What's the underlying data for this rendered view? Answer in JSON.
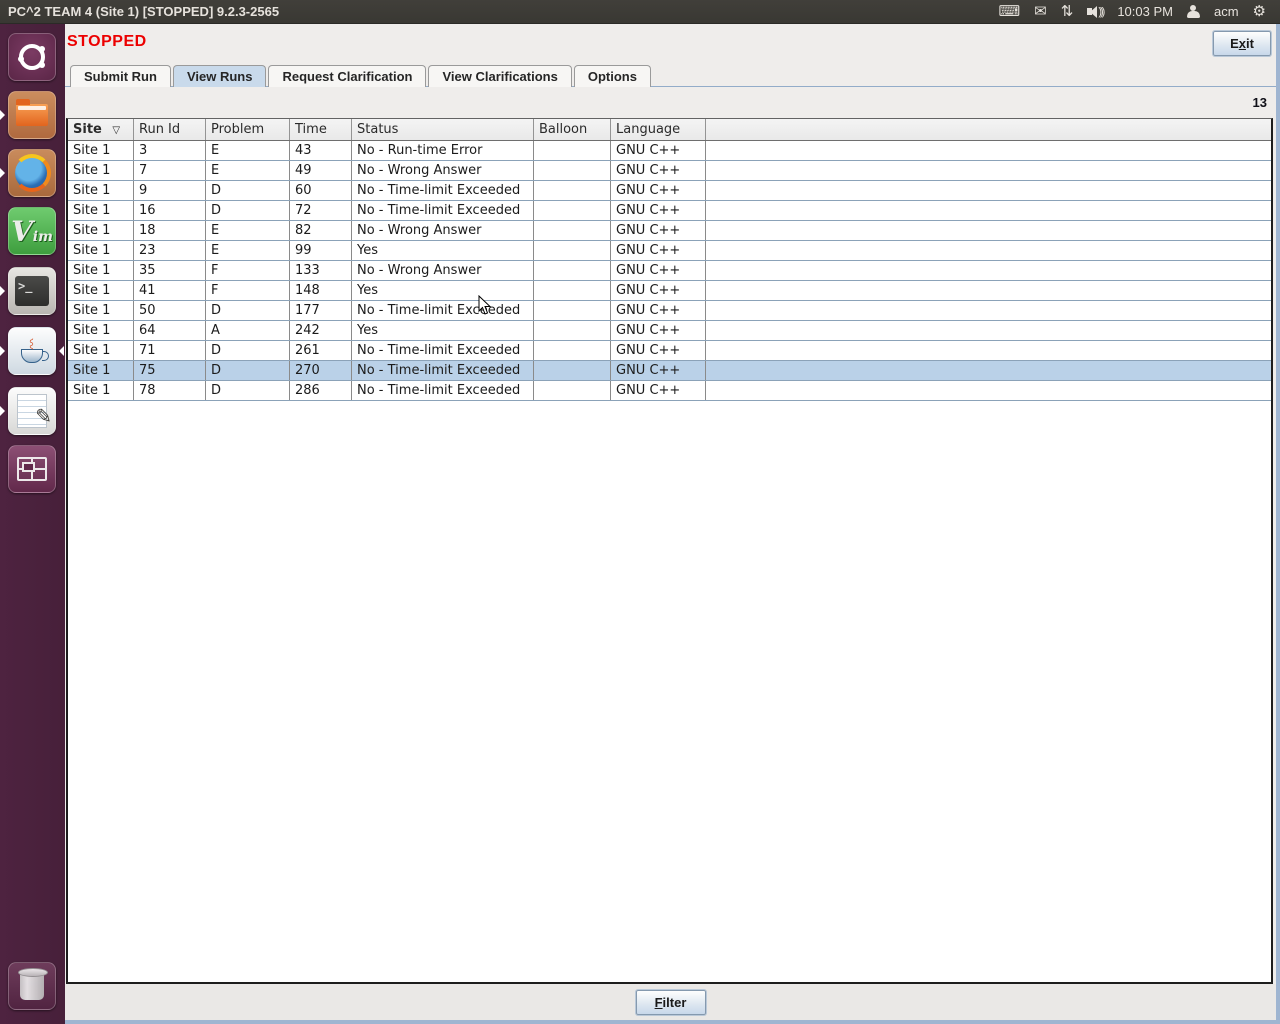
{
  "top_bar": {
    "title": "PC^2 TEAM 4 (Site 1) [STOPPED] 9.2.3-2565",
    "clock": "10:03 PM",
    "username": "acm",
    "keyboard_icon": "⌨",
    "mail_icon": "✉",
    "network_icon": "⇅",
    "speaker_waves": ")))",
    "gear_icon": "⚙"
  },
  "launcher": {
    "items": [
      {
        "name": "dash-home",
        "label": "Dash Home",
        "running": false,
        "focused": false
      },
      {
        "name": "files",
        "label": "Files",
        "running": true,
        "focused": false
      },
      {
        "name": "firefox",
        "label": "Firefox",
        "running": true,
        "focused": false
      },
      {
        "name": "vim",
        "label": "Vim",
        "running": false,
        "focused": false
      },
      {
        "name": "terminal",
        "label": "Terminal",
        "running": true,
        "focused": false
      },
      {
        "name": "java",
        "label": "Java",
        "running": true,
        "focused": true
      },
      {
        "name": "text-editor",
        "label": "Text Editor",
        "running": true,
        "focused": false
      },
      {
        "name": "workspace-switcher",
        "label": "Workspace Switcher",
        "running": false,
        "focused": false
      },
      {
        "name": "trash",
        "label": "Trash",
        "running": false,
        "focused": false
      }
    ]
  },
  "window": {
    "status_label": "STOPPED",
    "exit_button": {
      "pre": "E",
      "key": "x",
      "post": "it"
    },
    "tabs": [
      {
        "label": "Submit Run",
        "selected": false
      },
      {
        "label": "View Runs",
        "selected": true
      },
      {
        "label": "Request Clarification",
        "selected": false
      },
      {
        "label": "View Clarifications",
        "selected": false
      },
      {
        "label": "Options",
        "selected": false
      }
    ],
    "run_count": "13",
    "filter_button": {
      "pre": "",
      "key": "F",
      "post": "ilter"
    }
  },
  "table": {
    "columns": [
      "Site",
      "Run Id",
      "Problem",
      "Time",
      "Status",
      "Balloon",
      "Language"
    ],
    "sort_column": "Site",
    "sort_indicator": "▽",
    "selected_run_id": "75",
    "rows": [
      {
        "site": "Site 1",
        "run_id": "3",
        "problem": "E",
        "time": "43",
        "status": "No - Run-time Error",
        "balloon": "",
        "language": "GNU C++"
      },
      {
        "site": "Site 1",
        "run_id": "7",
        "problem": "E",
        "time": "49",
        "status": "No - Wrong Answer",
        "balloon": "",
        "language": "GNU C++"
      },
      {
        "site": "Site 1",
        "run_id": "9",
        "problem": "D",
        "time": "60",
        "status": "No - Time-limit Exceeded",
        "balloon": "",
        "language": "GNU C++"
      },
      {
        "site": "Site 1",
        "run_id": "16",
        "problem": "D",
        "time": "72",
        "status": "No - Time-limit Exceeded",
        "balloon": "",
        "language": "GNU C++"
      },
      {
        "site": "Site 1",
        "run_id": "18",
        "problem": "E",
        "time": "82",
        "status": "No - Wrong Answer",
        "balloon": "",
        "language": "GNU C++"
      },
      {
        "site": "Site 1",
        "run_id": "23",
        "problem": "E",
        "time": "99",
        "status": "Yes",
        "balloon": "",
        "language": "GNU C++"
      },
      {
        "site": "Site 1",
        "run_id": "35",
        "problem": "F",
        "time": "133",
        "status": "No - Wrong Answer",
        "balloon": "",
        "language": "GNU C++"
      },
      {
        "site": "Site 1",
        "run_id": "41",
        "problem": "F",
        "time": "148",
        "status": "Yes",
        "balloon": "",
        "language": "GNU C++"
      },
      {
        "site": "Site 1",
        "run_id": "50",
        "problem": "D",
        "time": "177",
        "status": "No - Time-limit Exceeded",
        "balloon": "",
        "language": "GNU C++"
      },
      {
        "site": "Site 1",
        "run_id": "64",
        "problem": "A",
        "time": "242",
        "status": "Yes",
        "balloon": "",
        "language": "GNU C++"
      },
      {
        "site": "Site 1",
        "run_id": "71",
        "problem": "D",
        "time": "261",
        "status": "No - Time-limit Exceeded",
        "balloon": "",
        "language": "GNU C++"
      },
      {
        "site": "Site 1",
        "run_id": "75",
        "problem": "D",
        "time": "270",
        "status": "No - Time-limit Exceeded",
        "balloon": "",
        "language": "GNU C++"
      },
      {
        "site": "Site 1",
        "run_id": "78",
        "problem": "D",
        "time": "286",
        "status": "No - Time-limit Exceeded",
        "balloon": "",
        "language": "GNU C++"
      }
    ]
  },
  "colors": {
    "topbar_bg": "#3C3B37",
    "launcher_bg": "#4E2340",
    "window_bg": "#EFEDEB",
    "selected_tab_bg": "#C9DAEB",
    "selected_row_bg": "#BAD1E8",
    "status_red": "#EC0000",
    "window_border_blue": "#9FB5D1"
  }
}
